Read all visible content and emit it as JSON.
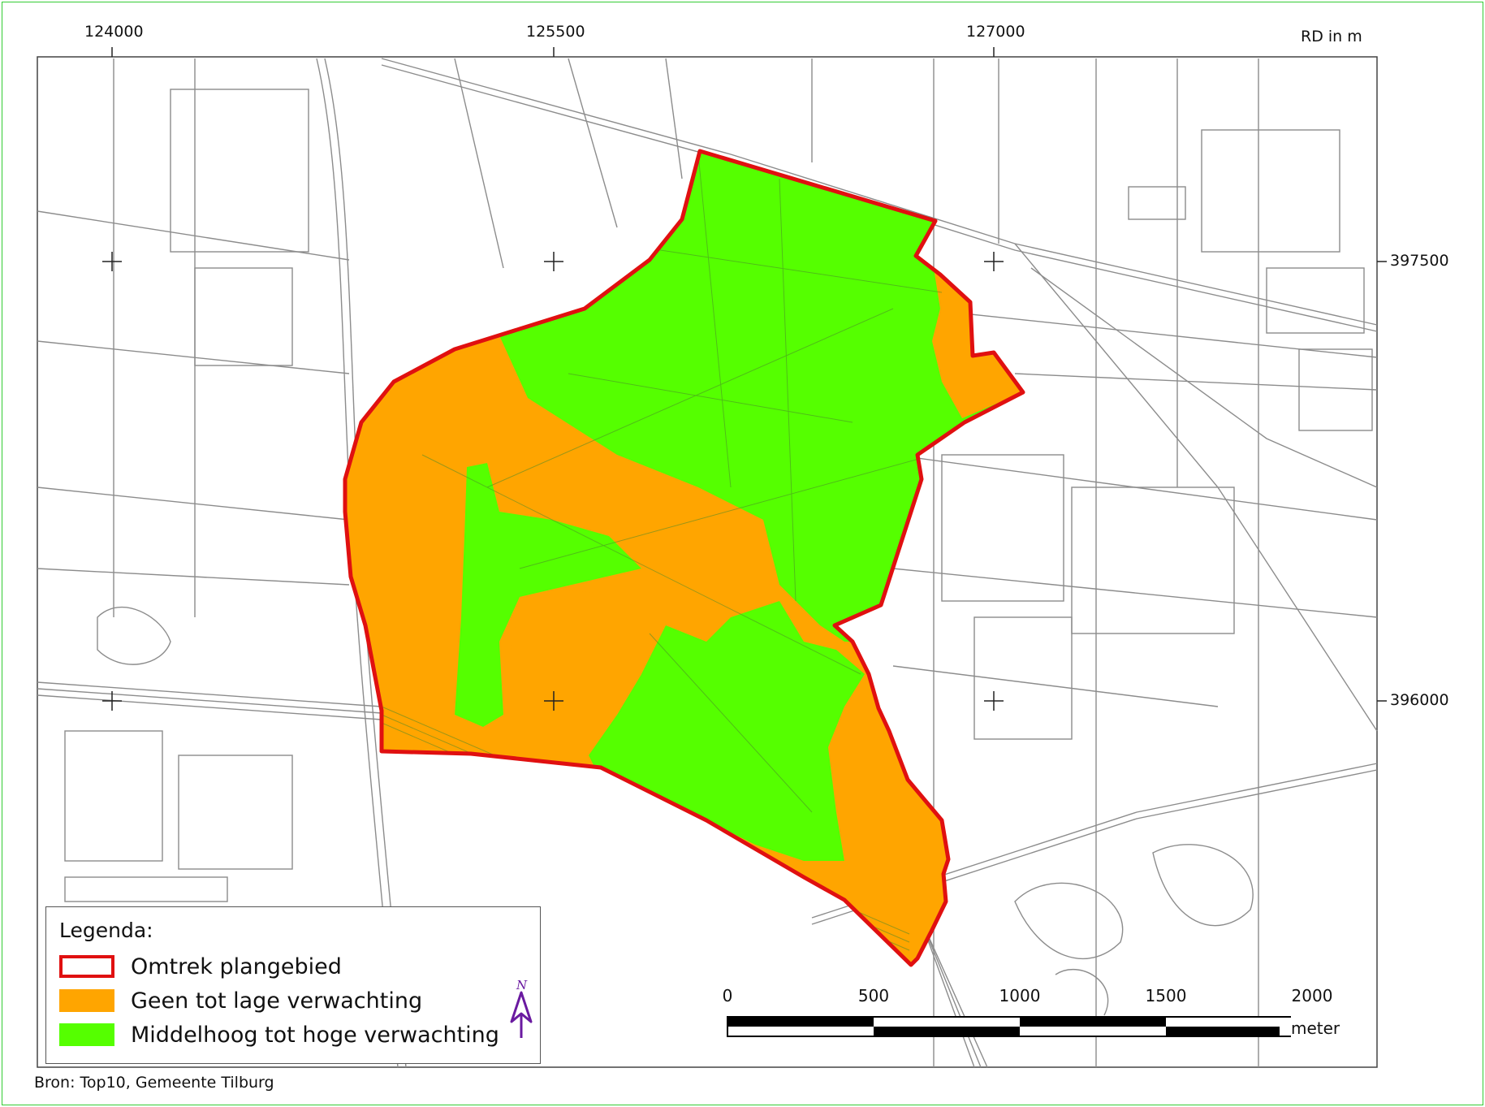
{
  "map": {
    "coord_unit_label": "RD in m",
    "x_ticks": [
      "124000",
      "125500",
      "127000"
    ],
    "y_ticks": [
      "397500",
      "396000"
    ]
  },
  "legend": {
    "title": "Legenda:",
    "items": [
      {
        "label": "Omtrek plangebied",
        "fill": "#ffffff",
        "stroke": "#e01010"
      },
      {
        "label": "Geen tot lage verwachting",
        "fill": "#ffa500",
        "stroke": "#ffa500"
      },
      {
        "label": "Middelhoog tot hoge verwachting",
        "fill": "#55ff00",
        "stroke": "#55ff00"
      }
    ],
    "north_label": "N"
  },
  "scale": {
    "ticks": [
      "0",
      "500",
      "1000",
      "1500",
      "2000"
    ],
    "unit": "meter"
  },
  "source": "Bron: Top10, Gemeente Tilburg",
  "colors": {
    "boundary": "#e01010",
    "low": "#ffa500",
    "high": "#55ff00",
    "roads": "#9a9a9a",
    "frame": "#33cc33"
  }
}
